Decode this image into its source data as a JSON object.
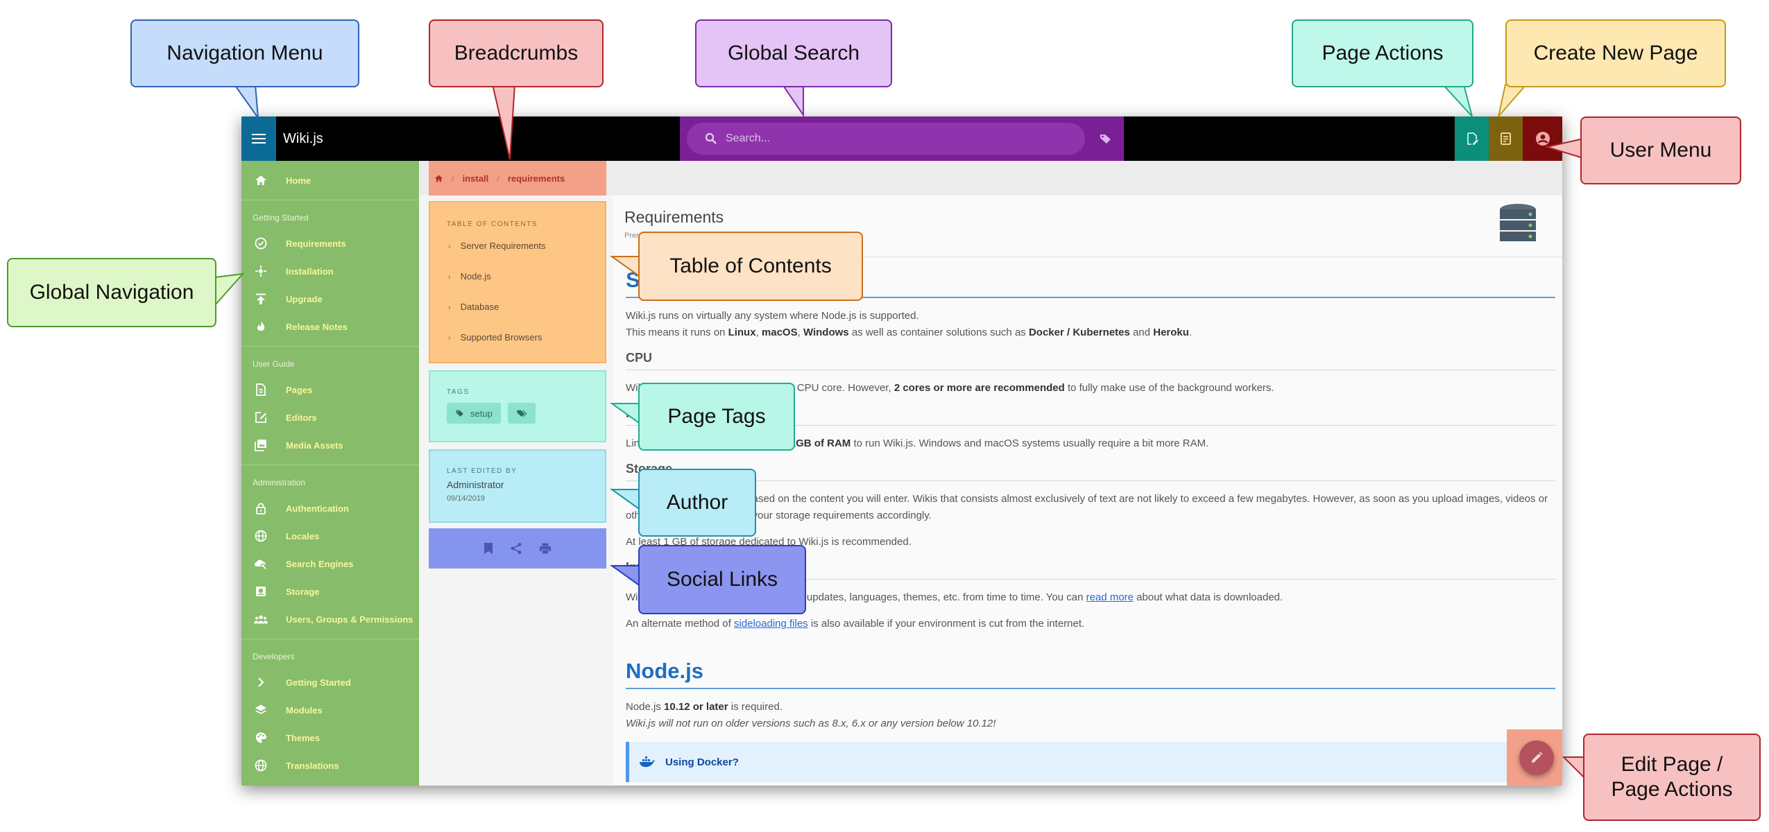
{
  "app": {
    "brand": "Wiki.js"
  },
  "topbar": {
    "search_placeholder": "Search...",
    "icons": {
      "menu": "hamburger-menu-icon",
      "search": "search-icon",
      "tags": "tag-icon",
      "page_actions": "file-edit-icon",
      "new_page": "file-plus-icon",
      "user": "user-circle-icon"
    }
  },
  "sidebar": {
    "home": "Home",
    "sections": [
      {
        "header": "Getting Started",
        "items": [
          {
            "label": "Requirements",
            "icon": "check-circle-icon"
          },
          {
            "label": "Installation",
            "icon": "settings-sparkle-icon"
          },
          {
            "label": "Upgrade",
            "icon": "upload-icon"
          },
          {
            "label": "Release Notes",
            "icon": "fire-icon"
          }
        ]
      },
      {
        "header": "User Guide",
        "items": [
          {
            "label": "Pages",
            "icon": "file-icon"
          },
          {
            "label": "Editors",
            "icon": "edit-box-icon"
          },
          {
            "label": "Media Assets",
            "icon": "images-icon"
          }
        ]
      },
      {
        "header": "Administration",
        "items": [
          {
            "label": "Authentication",
            "icon": "lock-icon"
          },
          {
            "label": "Locales",
            "icon": "globe-icon"
          },
          {
            "label": "Search Engines",
            "icon": "cloud-search-icon"
          },
          {
            "label": "Storage",
            "icon": "storage-icon"
          },
          {
            "label": "Users, Groups & Permissions",
            "icon": "users-icon"
          }
        ]
      },
      {
        "header": "Developers",
        "items": [
          {
            "label": "Getting Started",
            "icon": "chevron-right-icon"
          },
          {
            "label": "Modules",
            "icon": "layers-icon"
          },
          {
            "label": "Themes",
            "icon": "palette-icon"
          },
          {
            "label": "Translations",
            "icon": "globe-icon"
          }
        ]
      }
    ]
  },
  "breadcrumbs": {
    "home_icon": "home-icon",
    "sep": "/",
    "items": [
      "install",
      "requirements"
    ]
  },
  "toc": {
    "title": "TABLE OF CONTENTS",
    "items": [
      "Server Requirements",
      "Node.js",
      "Database",
      "Supported Browsers"
    ]
  },
  "tags": {
    "title": "TAGS",
    "chip": "setup"
  },
  "author": {
    "title": "LAST EDITED BY",
    "name": "Administrator",
    "date": "09/14/2019"
  },
  "social": {
    "icons": [
      "bookmark-icon",
      "share-icon",
      "print-icon"
    ]
  },
  "page": {
    "title": "Requirements",
    "subtitle": "Prerequisites to install Wiki.js",
    "h_server": "Server Requirements",
    "p1": "Wiki.js runs on virtually any system where Node.js is supported.",
    "p2": {
      "a": "This means it runs on ",
      "b1": "Linux",
      "c": ", ",
      "b2": "macOS",
      "d": ", ",
      "b3": "Windows",
      "e": " as well as container solutions such as ",
      "b4": "Docker / Kubernetes",
      "f": " and ",
      "b5": "Heroku",
      "g": "."
    },
    "h_cpu": "CPU",
    "cpu": {
      "a": "Wiki.js runs perfectly fine on a single CPU core. However, ",
      "b": "2 cores or more are recommended",
      "c": " to fully make use of the background workers."
    },
    "h_ram": "RAM",
    "ram": {
      "a": "Linux systems should have at least ",
      "b": "1GB of RAM",
      "c": " to run Wiki.js. Windows and macOS systems usually require a bit more RAM."
    },
    "h_storage": "Storage",
    "storage1": "Storage requirements are based on the content you will enter. Wikis that consists almost exclusively of text are not likely to exceed a few megabytes. However, as soon as you upload images, videos or other files, you should plan your storage requirements accordingly.",
    "storage2": "At least 1 GB of storage dedicated to Wiki.js is recommended.",
    "h_internet": "Internet Access",
    "internet1": {
      "a": "Wiki.js will automatically check for new updates, languages, themes, etc. from time to time. You can ",
      "link": "read more",
      "b": " about what data is downloaded."
    },
    "internet2": {
      "a": "An alternate method of ",
      "link": "sideloading files",
      "b": " is also available if your environment is cut from the internet."
    },
    "h_node": "Node.js",
    "node1": {
      "a": "Node.js ",
      "b": "10.12 or later",
      "c": " is required."
    },
    "node2": "Wiki.js will not run on older versions such as 8.x, 6.x or any version below 10.12!",
    "docker": "Using Docker?"
  },
  "callouts": {
    "nav_menu": "Navigation Menu",
    "breadcrumbs": "Breadcrumbs",
    "global_search": "Global Search",
    "page_actions": "Page Actions",
    "create_page": "Create New Page",
    "user_menu": "User Menu",
    "global_nav": "Global Navigation",
    "toc": "Table of Contents",
    "tags": "Page Tags",
    "author": "Author",
    "social": "Social Links",
    "edit_page_l1": "Edit Page /",
    "edit_page_l2": "Page Actions"
  },
  "colors": {
    "sidebar": "#86bc6a",
    "search": "#7b1f97",
    "toc": "#fdc685",
    "tags": "#b8f6e7",
    "author": "#b8ecf6",
    "social": "#8595ee",
    "heading": "#1e6dc4"
  }
}
